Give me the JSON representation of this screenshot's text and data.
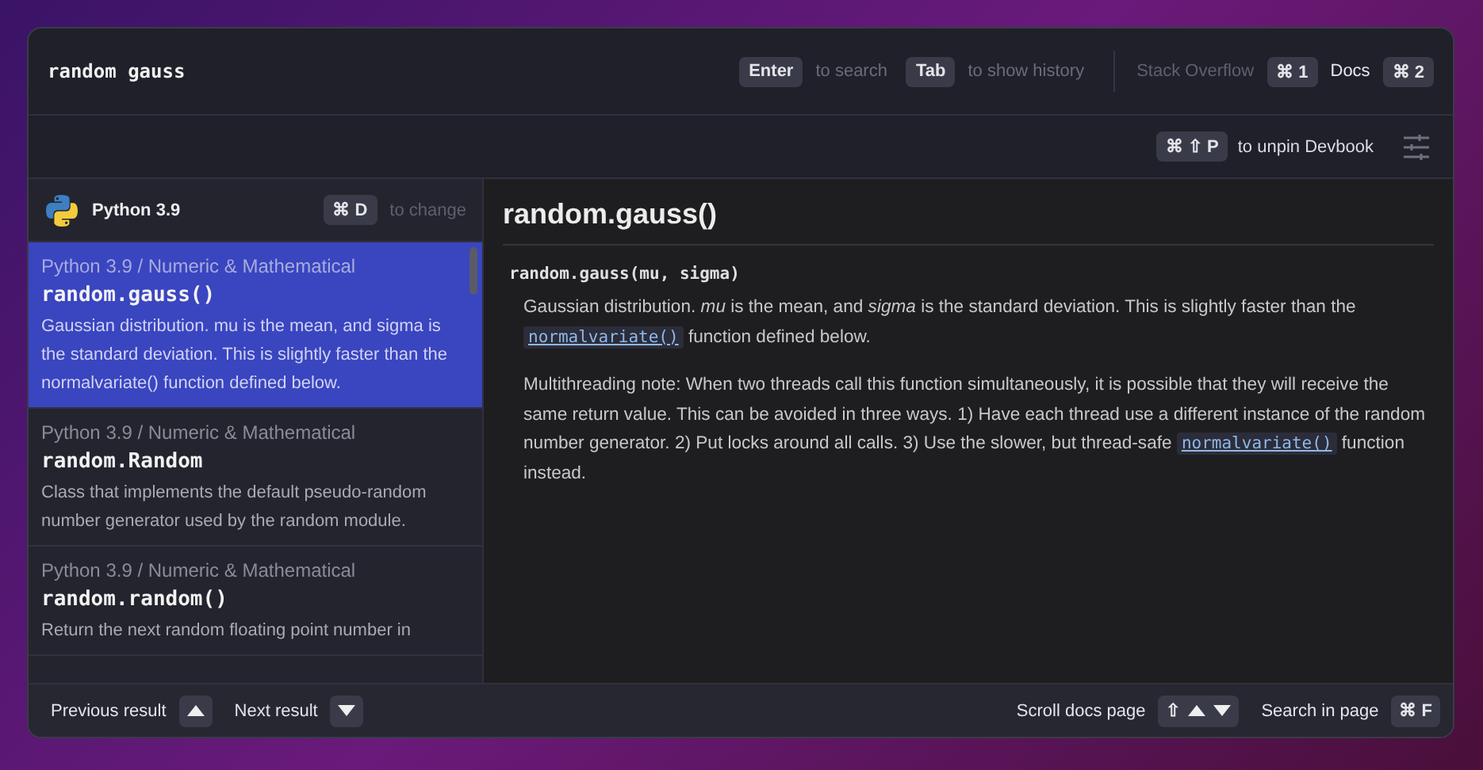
{
  "search": {
    "value": "random gauss"
  },
  "hints": [
    {
      "key": "Enter",
      "label": "to search"
    },
    {
      "key": "Tab",
      "label": "to show history"
    }
  ],
  "sources": [
    {
      "label": "Stack Overflow",
      "key": "⌘ 1",
      "selected": false
    },
    {
      "label": "Docs",
      "key": "⌘ 2",
      "selected": true
    }
  ],
  "pin_bar": {
    "key": "⌘ ⇧ P",
    "label": "to unpin Devbook"
  },
  "sidebar": {
    "title": "Python 3.9",
    "key": "⌘ D",
    "hint": "to change",
    "results": [
      {
        "path": "Python 3.9 / Numeric & Mathematical",
        "title": "random.gauss()",
        "description": "Gaussian distribution. mu is the mean, and sigma is the standard deviation. This is slightly faster than the normalvariate() function defined below.",
        "selected": true
      },
      {
        "path": "Python 3.9 / Numeric & Mathematical",
        "title": "random.Random",
        "description": "Class that implements the default pseudo-random number generator used by the random module.",
        "selected": false
      },
      {
        "path": "Python 3.9 / Numeric & Mathematical",
        "title": "random.random()",
        "description": "Return the next random floating point number in",
        "selected": false
      }
    ]
  },
  "doc": {
    "title": "random.gauss()",
    "signature": "random.gauss(mu, sigma)",
    "paragraphs": [
      [
        {
          "kind": "text",
          "text": "Gaussian distribution. *mu* is the mean, and *sigma* is the standard deviation. This is slightly faster than the "
        },
        {
          "kind": "code",
          "text": "normalvariate()"
        },
        {
          "kind": "text",
          "text": " function defined below."
        }
      ],
      [
        {
          "kind": "text",
          "text": "Multithreading note: When two threads call this function simultaneously, it is possible that they will receive the same return value. This can be avoided in three ways. 1) Have each thread use a different instance of the random number generator. 2) Put locks around all calls. 3) Use the slower, but thread-safe "
        },
        {
          "kind": "code",
          "text": "normalvariate()"
        },
        {
          "kind": "text",
          "text": " function instead."
        }
      ]
    ]
  },
  "footer": {
    "left": [
      {
        "label": "Previous result",
        "keys": [
          {
            "kind": "up"
          }
        ]
      },
      {
        "label": "Next result",
        "keys": [
          {
            "kind": "down"
          }
        ]
      }
    ],
    "right": [
      {
        "label": "Scroll docs page",
        "keys": [
          {
            "kind": "text",
            "text": "⇧"
          },
          {
            "kind": "up"
          },
          {
            "kind": "down"
          }
        ]
      },
      {
        "label": "Search in page",
        "keys": [
          {
            "kind": "text",
            "text": "⌘ F"
          }
        ]
      }
    ]
  }
}
